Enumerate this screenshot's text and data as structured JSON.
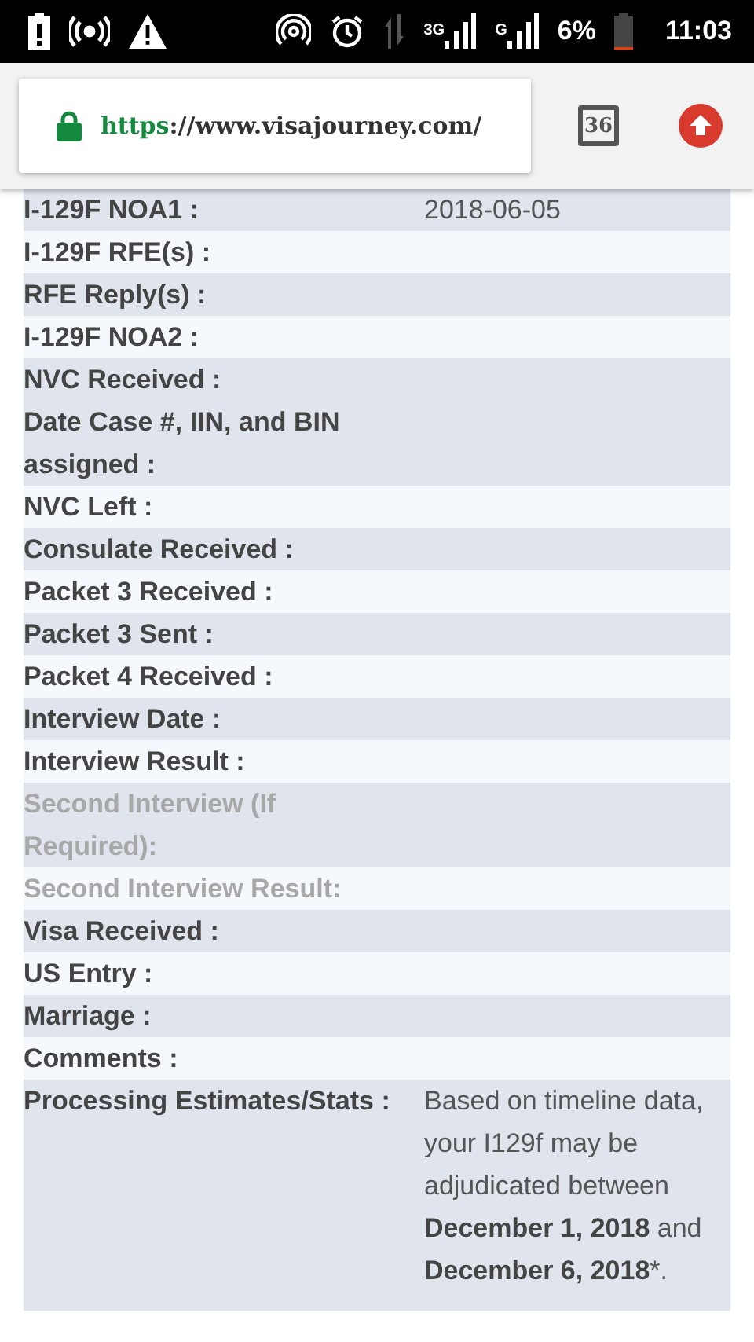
{
  "status_bar": {
    "network": "3G",
    "network_2": "G",
    "battery": "6%",
    "time": "11:03"
  },
  "browser": {
    "url_scheme": "https",
    "url_rest": "://www.visajourney.com/",
    "tab_count": "36"
  },
  "rows": [
    {
      "label": "I-129F NOA1 :",
      "value": "2018-06-05",
      "shaded": true,
      "disabled": false
    },
    {
      "label": "I-129F RFE(s) :",
      "shaded": false,
      "disabled": false
    },
    {
      "label": "RFE Reply(s) :",
      "shaded": true,
      "disabled": false
    },
    {
      "label": "I-129F NOA2 :",
      "shaded": false,
      "disabled": false
    },
    {
      "label": "NVC Received :",
      "shaded": true,
      "disabled": false
    },
    {
      "label": "Date Case #, IIN, and BIN assigned :",
      "shaded": true,
      "disabled": false
    },
    {
      "label": "NVC Left :",
      "shaded": false,
      "disabled": false
    },
    {
      "label": "Consulate Received :",
      "shaded": true,
      "disabled": false
    },
    {
      "label": "Packet 3 Received :",
      "shaded": false,
      "disabled": false
    },
    {
      "label": "Packet 3 Sent :",
      "shaded": true,
      "disabled": false
    },
    {
      "label": "Packet 4 Received :",
      "shaded": false,
      "disabled": false
    },
    {
      "label": "Interview Date :",
      "shaded": true,
      "disabled": false
    },
    {
      "label": "Interview Result :",
      "shaded": false,
      "disabled": false
    },
    {
      "label": "Second Interview (If Required):",
      "shaded": true,
      "disabled": true
    },
    {
      "label": "Second Interview Result:",
      "shaded": false,
      "disabled": true
    },
    {
      "label": "Visa Received :",
      "shaded": true,
      "disabled": false
    },
    {
      "label": "US Entry :",
      "shaded": false,
      "disabled": false
    },
    {
      "label": "Marriage :",
      "shaded": true,
      "disabled": false
    },
    {
      "label": "Comments :",
      "shaded": false,
      "disabled": false
    },
    {
      "label": "Processing Estimates/Stats :",
      "value": "Based on timeline data, your I129f may be adjudicated between **December 1, 2018** and **December 6, 2018***.",
      "shaded": true,
      "disabled": false
    }
  ]
}
